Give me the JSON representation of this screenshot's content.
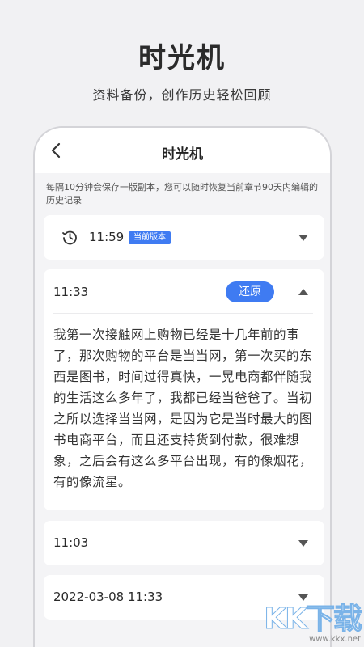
{
  "hero": {
    "title": "时光机",
    "subtitle": "资料备份，创作历史轻松回顾"
  },
  "nav": {
    "title": "时光机",
    "back_icon": "chevron-left-icon"
  },
  "notice": "每隔10分钟会保存一版副本，您可以随时恢复当前章节90天内编辑的历史记录",
  "versions": [
    {
      "time": "11:59",
      "badge": "当前版本",
      "expanded": false
    },
    {
      "time": "11:33",
      "action": "还原",
      "expanded": true,
      "content": "我第一次接触网上购物已经是十几年前的事了，那次购物的平台是当当网，第一次买的东西是图书，时间过得真快，一晃电商都伴随我的生活这么多年了，我都已经当爸爸了。当初之所以选择当当网，是因为它是当时最大的图书电商平台，而且还支持货到付款，很难想象，之后会有这么多平台出现，有的像烟花，有的像流星。"
    },
    {
      "time": "11:03",
      "expanded": false
    },
    {
      "time": "2022-03-08 11:33",
      "expanded": false
    }
  ],
  "watermark": {
    "main": "KK下载",
    "url": "www.kkx.net"
  },
  "colors": {
    "accent": "#3f7bf2",
    "background": "#f1f1f3"
  }
}
